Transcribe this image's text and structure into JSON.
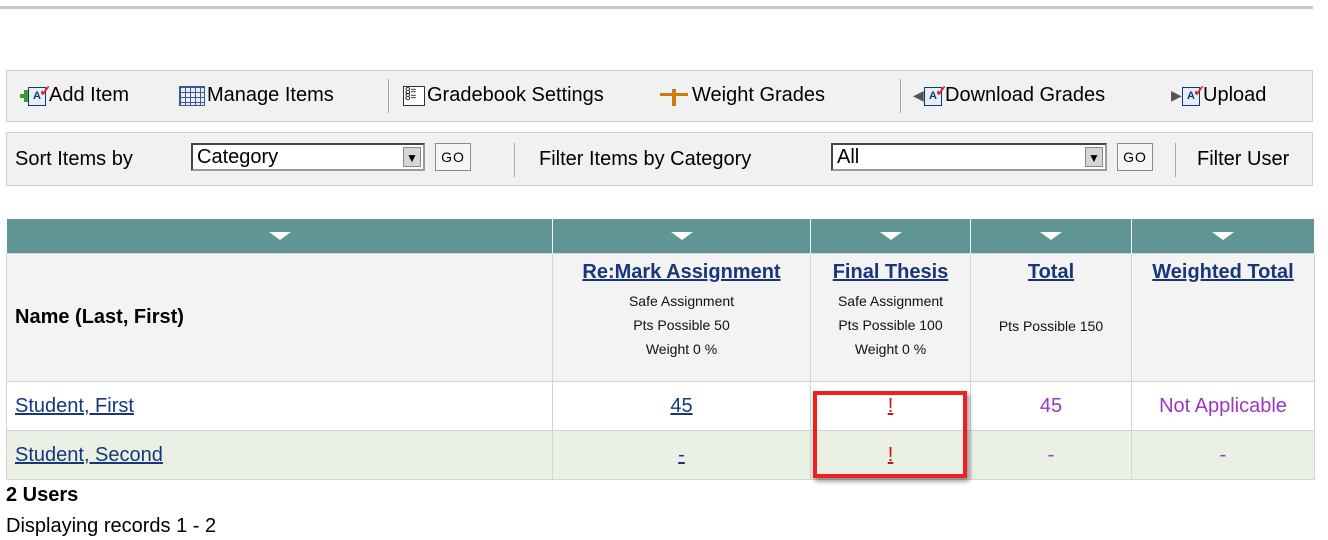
{
  "toolbar": {
    "add_item": "Add Item",
    "manage_items": "Manage Items",
    "gradebook_settings": "Gradebook Settings",
    "weight_grades": "Weight Grades",
    "download_grades": "Download Grades",
    "upload": "Upload"
  },
  "filters": {
    "sort_label": "Sort Items by",
    "sort_value": "Category",
    "go": "GO",
    "filter_category_label": "Filter Items by Category",
    "filter_category_value": "All",
    "filter_user_label": "Filter User"
  },
  "grid": {
    "name_header": "Name (Last, First)",
    "columns": [
      {
        "title": "Re:Mark Assignment",
        "type": "Safe Assignment",
        "points": "Pts Possible 50",
        "weight": "Weight 0 %"
      },
      {
        "title": "Final Thesis",
        "type": "Safe Assignment",
        "points": "Pts Possible 100",
        "weight": "Weight 0 %"
      },
      {
        "title": "Total",
        "points": "Pts Possible 150"
      },
      {
        "title": "Weighted Total"
      }
    ],
    "rows": [
      {
        "name": "Student, First",
        "cells": [
          "45",
          "!",
          "45",
          "Not Applicable"
        ]
      },
      {
        "name": "Student, Second",
        "cells": [
          "-",
          "!",
          "-",
          "-"
        ]
      }
    ]
  },
  "footer": {
    "users": "2 Users",
    "records": "Displaying records 1 - 2"
  },
  "colors": {
    "header_bar": "#5f9595",
    "link": "#17377a",
    "exception": "#c01818",
    "computed": "#9a37c4",
    "highlight": "#ee2020"
  }
}
